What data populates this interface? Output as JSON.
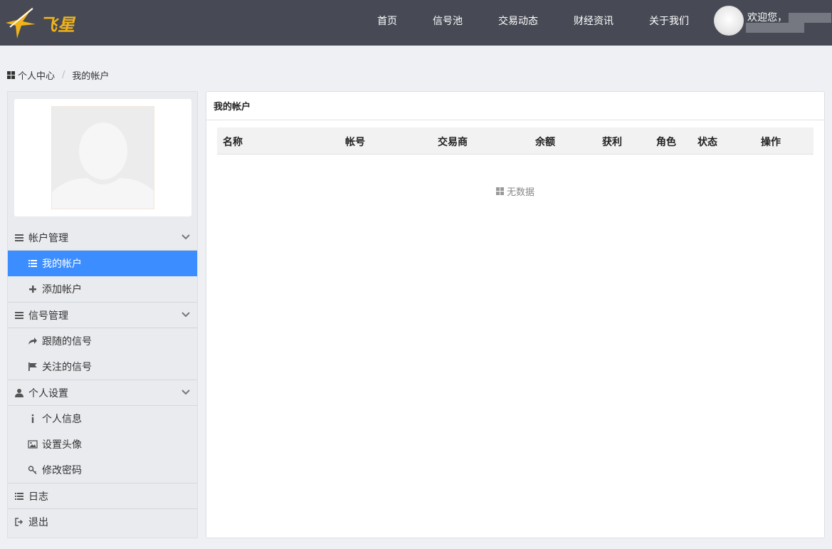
{
  "header": {
    "logo_text": "飞星",
    "nav": [
      "首页",
      "信号池",
      "交易动态",
      "财经资讯",
      "关于我们"
    ],
    "welcome": "欢迎您，"
  },
  "breadcrumb": {
    "root": "个人中心",
    "current": "我的帐户"
  },
  "sidebar": {
    "groups": [
      {
        "label": "帐户管理",
        "items": [
          "我的帐户",
          "添加帐户"
        ]
      },
      {
        "label": "信号管理",
        "items": [
          "跟随的信号",
          "关注的信号"
        ]
      },
      {
        "label": "个人设置",
        "items": [
          "个人信息",
          "设置头像",
          "修改密码"
        ]
      }
    ],
    "log": "日志",
    "logout": "退出"
  },
  "main": {
    "title": "我的帐户",
    "columns": [
      "名称",
      "帐号",
      "交易商",
      "余额",
      "获利",
      "角色",
      "状态",
      "操作"
    ],
    "empty_text": "无数据"
  },
  "colors": {
    "header_bg": "#474a55",
    "accent": "#3c8dff",
    "logo": "#f0b31a"
  }
}
